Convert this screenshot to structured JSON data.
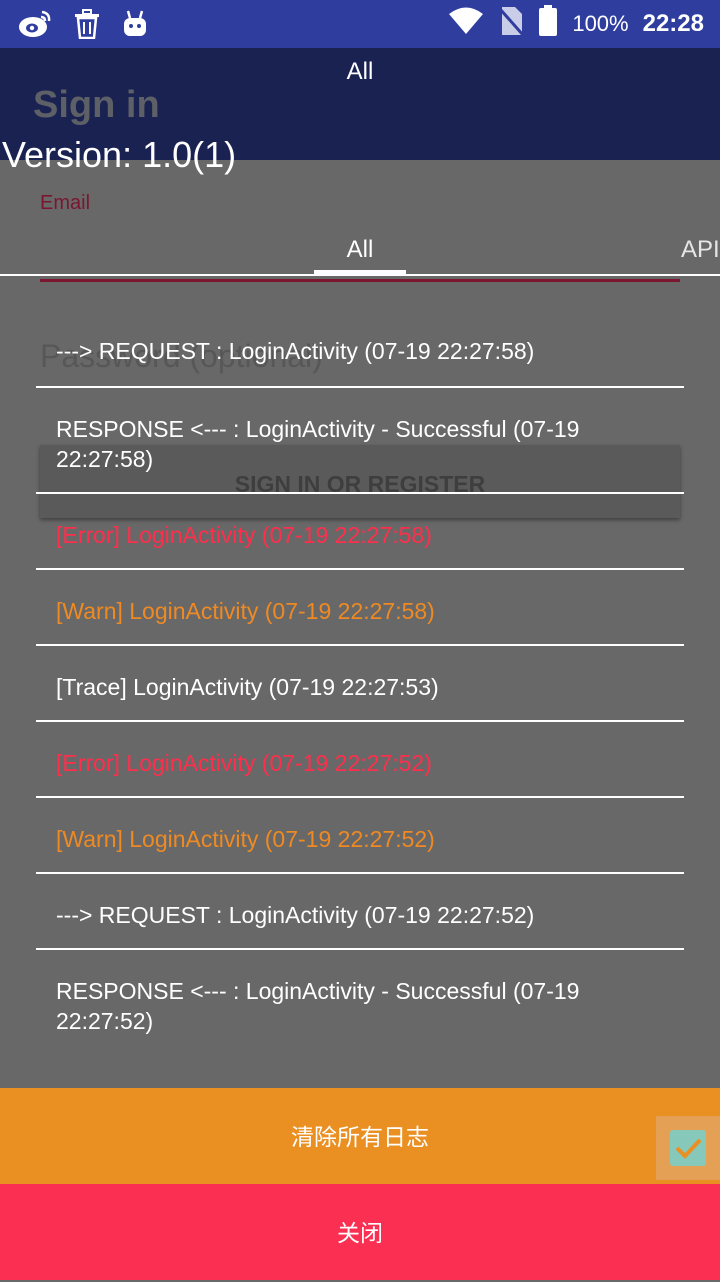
{
  "status_bar": {
    "icons": [
      "weibo-icon",
      "trash-icon",
      "android-icon",
      "wifi-icon",
      "no-sim-icon",
      "battery-icon"
    ],
    "battery": "100%",
    "time": "22:28"
  },
  "app_bar": {
    "title": "All"
  },
  "background": {
    "sign_in_title": "Sign in",
    "email_label": "Email",
    "password_placeholder": "Password (optional)",
    "sign_in_button": "SIGN IN OR REGISTER"
  },
  "version": "Version: 1.0(1)",
  "tabs": [
    {
      "label": "All",
      "selected": true
    },
    {
      "label": "API",
      "selected": false
    }
  ],
  "logs": [
    {
      "text": "---> REQUEST : LoginActivity (07-19 22:27:58)",
      "level": "request",
      "color": "#ffffff"
    },
    {
      "text": "RESPONSE <--- : LoginActivity - Successful (07-19 22:27:58)",
      "level": "response",
      "color": "#ffffff"
    },
    {
      "text": "[Error] LoginActivity (07-19 22:27:58)",
      "level": "error",
      "color": "#ff2e4c"
    },
    {
      "text": "[Warn] LoginActivity (07-19 22:27:58)",
      "level": "warn",
      "color": "#ef8a23"
    },
    {
      "text": "[Trace] LoginActivity (07-19 22:27:53)",
      "level": "trace",
      "color": "#ffffff"
    },
    {
      "text": "[Error] LoginActivity (07-19 22:27:52)",
      "level": "error",
      "color": "#ff2e4c"
    },
    {
      "text": "[Warn] LoginActivity (07-19 22:27:52)",
      "level": "warn",
      "color": "#ef8a23"
    },
    {
      "text": "---> REQUEST : LoginActivity (07-19 22:27:52)",
      "level": "request",
      "color": "#ffffff"
    },
    {
      "text": "RESPONSE <--- : LoginActivity - Successful (07-19 22:27:52)",
      "level": "response",
      "color": "#ffffff"
    }
  ],
  "actions": {
    "clear_all": "清除所有日志",
    "close": "关闭"
  },
  "colors": {
    "status_bar": "#2f3d9f",
    "app_bar": "#1a2252",
    "overlay": "#686868",
    "clear_button": "#ea8f22",
    "close_button": "#fb2f51"
  }
}
